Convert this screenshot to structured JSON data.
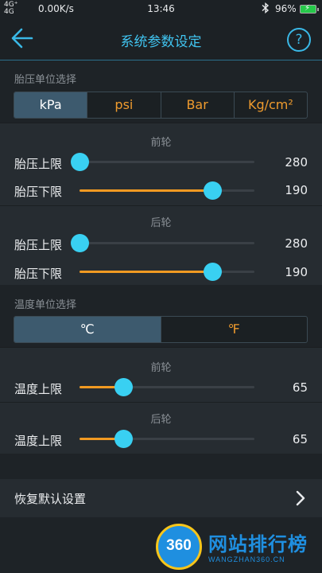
{
  "status_bar": {
    "signal_left": "4G⁺",
    "signal_left2": "4G",
    "network_speed": "0.00K/s",
    "time": "13:46",
    "battery_percent": "96%",
    "battery_charging": true
  },
  "header": {
    "title": "系统参数设定",
    "help_glyph": "?"
  },
  "pressure_unit": {
    "section_label": "胎压单位选择",
    "options": [
      "kPa",
      "psi",
      "Bar",
      "Kg/cm²"
    ],
    "selected": "kPa"
  },
  "pressure_front": {
    "label": "前轮",
    "upper": {
      "label": "胎压上限",
      "value": "280",
      "level": 0.0
    },
    "lower": {
      "label": "胎压下限",
      "value": "190",
      "level": 0.76
    }
  },
  "pressure_rear": {
    "label": "后轮",
    "upper": {
      "label": "胎压上限",
      "value": "280",
      "level": 0.0
    },
    "lower": {
      "label": "胎压下限",
      "value": "190",
      "level": 0.76
    }
  },
  "temp_unit": {
    "section_label": "温度单位选择",
    "options": [
      "℃",
      "℉"
    ],
    "selected": "℃"
  },
  "temp_front": {
    "label": "前轮",
    "upper": {
      "label": "温度上限",
      "value": "65",
      "level": 0.25
    }
  },
  "temp_rear": {
    "label": "后轮",
    "upper": {
      "label": "温度上限",
      "value": "65",
      "level": 0.25
    }
  },
  "restore": {
    "label": "恢复默认设置"
  },
  "watermark": {
    "logo_text": "360",
    "title": "网站排行榜",
    "subtitle": "WANGZHAN360.CN"
  },
  "colors": {
    "accent": "#40c4f0",
    "slider_fill": "#f19a22",
    "slider_thumb": "#39d0f2",
    "segment_text": "#ef9b2e",
    "segment_selected_bg": "#3d5a6e"
  }
}
